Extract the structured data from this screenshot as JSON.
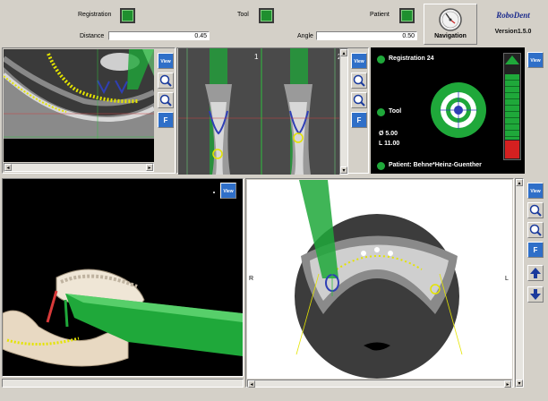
{
  "toolbar": {
    "registration_label": "Registration",
    "tool_label": "Tool",
    "patient_label": "Patient",
    "distance_label": "Distance",
    "distance_value": "0.45",
    "angle_label": "Angle",
    "angle_value": "0.50",
    "navigation_label": "Navigation",
    "brand_name": "RoboDent",
    "version": "Version1.5.0"
  },
  "panels": {
    "view_label": "View",
    "slice_labels": [
      "1",
      "2"
    ],
    "side_left": "R",
    "side_right": "L"
  },
  "status": {
    "registration": "Registration 24",
    "tool": "Tool",
    "diameter": "Ø 5.00",
    "length": "L 11.00",
    "patient": "Patient: Behne*Heinz-Guenther",
    "depth_level": 0.78
  },
  "colors": {
    "panel_bg": "#d4d0c8",
    "led_green": "#1f8f2f",
    "tool_green": "#1fa83a",
    "target_blue": "#2f3fb5",
    "alert_red": "#d42020"
  }
}
